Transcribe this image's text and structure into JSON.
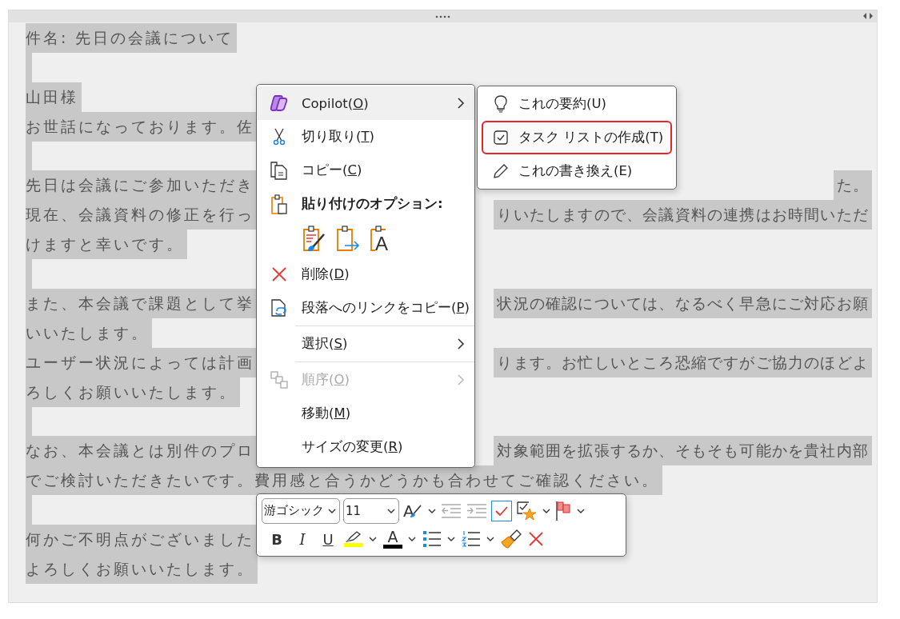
{
  "document": {
    "lines": [
      {
        "kind": "text",
        "left": "件名: 先日の会議について"
      },
      {
        "kind": "blank"
      },
      {
        "kind": "text",
        "left": "山田様"
      },
      {
        "kind": "text",
        "left": "お世話になっております。佐"
      },
      {
        "kind": "blank"
      },
      {
        "kind": "text",
        "left": "先日は会議にご参加いただき",
        "right": "た。"
      },
      {
        "kind": "text",
        "left": "現在、会議資料の修正を行っ",
        "right": "りいたしますので、会議資料の連携はお時間いただ"
      },
      {
        "kind": "text",
        "left": "けますと幸いです。"
      },
      {
        "kind": "blank"
      },
      {
        "kind": "text",
        "left": "また、本会議で課題として挙",
        "right": "状況の確認については、なるべく早急にご対応お願"
      },
      {
        "kind": "text",
        "left": "いいたします。"
      },
      {
        "kind": "text",
        "left": "ユーザー状況によっては計画",
        "right": "ります。お忙しいところ恐縮ですがご協力のほどよ"
      },
      {
        "kind": "text",
        "left": "ろしくお願いいたします。"
      },
      {
        "kind": "blank"
      },
      {
        "kind": "text",
        "left": "なお、本会議とは別件のプロ",
        "right": "対象範囲を拡張するか、そもそも可能かを貴社内部"
      },
      {
        "kind": "text",
        "left": "でご検討いただきたいです。費用感と合うかどうかも合わせてご確認ください。"
      },
      {
        "kind": "blank"
      },
      {
        "kind": "text",
        "left": "何かご不明点がございました"
      },
      {
        "kind": "text",
        "left": "よろしくお願いいたします。"
      }
    ]
  },
  "context_menu": {
    "items": [
      {
        "kind": "item",
        "label": "Copilot(O)",
        "submenu": true,
        "selected": true,
        "disabled": false
      },
      {
        "kind": "item",
        "label": "切り取り(T)",
        "submenu": false,
        "selected": false,
        "disabled": false
      },
      {
        "kind": "item",
        "label": "コピー(C)",
        "submenu": false,
        "selected": false,
        "disabled": false
      },
      {
        "kind": "header",
        "label": "貼り付けのオプション:"
      },
      {
        "kind": "paste_row",
        "options": [
          {
            "kind": "keep"
          },
          {
            "kind": "merge"
          },
          {
            "kind": "text",
            "glyph": "A"
          }
        ]
      },
      {
        "kind": "item",
        "label": "削除(D)",
        "submenu": false,
        "selected": false,
        "disabled": false
      },
      {
        "kind": "item",
        "label": "段落へのリンクをコピー(P)",
        "submenu": false,
        "selected": false,
        "disabled": false
      },
      {
        "kind": "divider"
      },
      {
        "kind": "item",
        "label": "選択(S)",
        "submenu": true,
        "selected": false,
        "disabled": false
      },
      {
        "kind": "divider"
      },
      {
        "kind": "item",
        "label": "順序(O)",
        "submenu": true,
        "selected": false,
        "disabled": true
      },
      {
        "kind": "item",
        "label": "移動(M)",
        "submenu": false,
        "selected": false,
        "disabled": false
      },
      {
        "kind": "item",
        "label": "サイズの変更(R)",
        "submenu": false,
        "selected": false,
        "disabled": false
      }
    ]
  },
  "submenu": {
    "items": [
      {
        "label": "これの要約(U)",
        "highlighted": false
      },
      {
        "label": "タスク リストの作成(T)",
        "highlighted": true
      },
      {
        "label": "これの書き換え(E)",
        "highlighted": false
      }
    ]
  },
  "toolbar": {
    "font": "游ゴシック",
    "size": "11",
    "styles_glyph": "A",
    "todo_checked": true,
    "bold": "B",
    "italic": "I",
    "underline": "U",
    "font_color_glyph": "A"
  }
}
